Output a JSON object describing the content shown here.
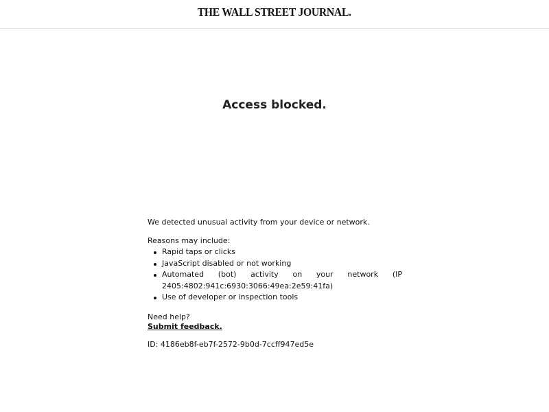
{
  "header": {
    "logo_text": "THE WALL STREET JOURNAL."
  },
  "main": {
    "title": "Access blocked.",
    "intro": "We detected unusual activity from your device or network.",
    "reasons_heading": "Reasons may include:",
    "reasons": [
      "Rapid taps or clicks",
      "JavaScript disabled or not working",
      "Automated (bot) activity on your network (IP",
      "2405:4802:941c:6930:3066:49ea:2e59:41fa)",
      "Use of developer or inspection tools"
    ],
    "help_text": "Need help?",
    "feedback_link": "Submit feedback.",
    "id_text": "ID: 4186eb8f-eb7f-2572-9b0d-7ccff947ed5e"
  }
}
